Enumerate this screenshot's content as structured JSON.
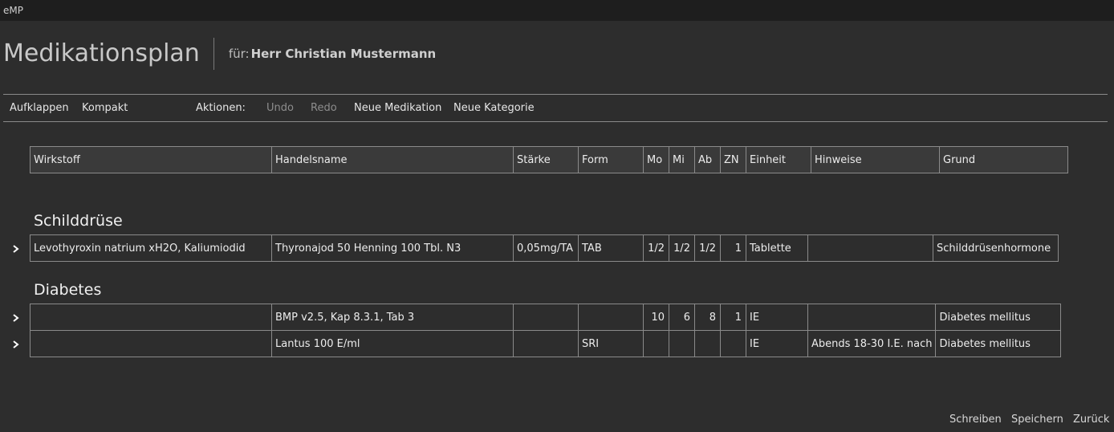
{
  "window": {
    "title": "eMP"
  },
  "header": {
    "title": "Medikationsplan",
    "patient_prefix": "für:",
    "patient_name": "Herr Christian Mustermann"
  },
  "toolbar": {
    "expand": "Aufklappen",
    "compact": "Kompakt",
    "actions_label": "Aktionen:",
    "undo": "Undo",
    "redo": "Redo",
    "new_medication": "Neue Medikation",
    "new_category": "Neue Kategorie"
  },
  "columns": [
    "Wirkstoff",
    "Handelsname",
    "Stärke",
    "Form",
    "Mo",
    "Mi",
    "Ab",
    "ZN",
    "Einheit",
    "Hinweise",
    "Grund"
  ],
  "categories": [
    {
      "name": "Schilddrüse",
      "rows": [
        [
          "Levothyroxin natrium xH2O, Kaliumiodid",
          "Thyronajod 50 Henning 100 Tbl. N3",
          "0,05mg/TA",
          "TAB",
          "1/2",
          "1/2",
          "1/2",
          "1",
          "Tablette",
          "",
          "Schilddrüsenhormone"
        ]
      ]
    },
    {
      "name": "Diabetes",
      "rows": [
        [
          "",
          "BMP v2.5, Kap 8.3.1, Tab 3",
          "",
          "",
          "10",
          "6",
          "8",
          "1",
          "IE",
          "",
          "Diabetes mellitus"
        ],
        [
          "",
          "Lantus 100 E/ml",
          "",
          "SRI",
          "",
          "",
          "",
          "",
          "IE",
          "Abends 18-30 I.E. nach",
          "Diabetes mellitus"
        ]
      ]
    }
  ],
  "row_expand_icon": "chevron-right-icon",
  "footer": {
    "write": "Schreiben",
    "save": "Speichern",
    "back": "Zurück"
  }
}
